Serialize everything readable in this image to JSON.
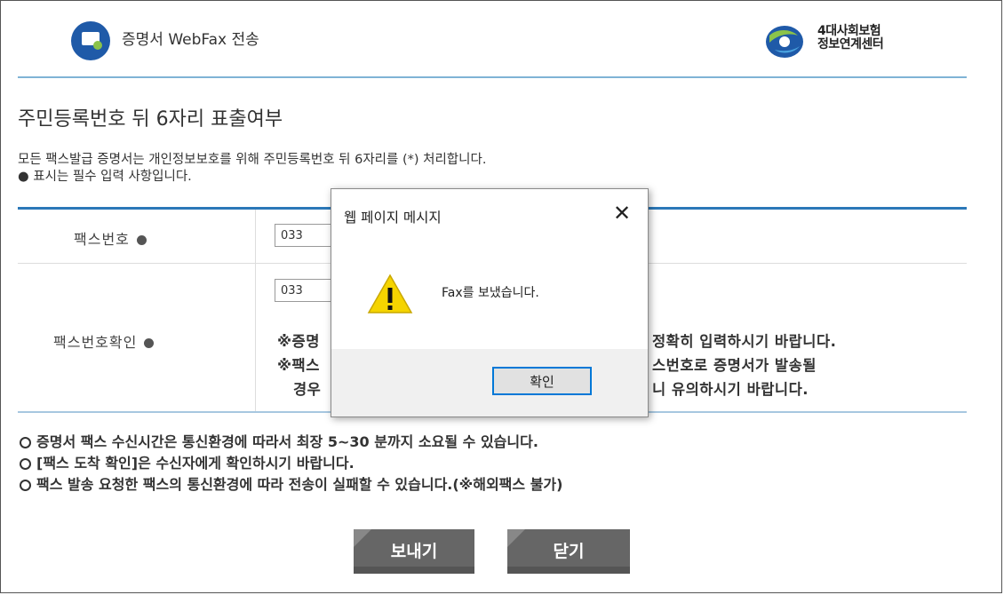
{
  "header": {
    "app_title": "증명서 WebFax 전송",
    "brand_line1": "4대사회보험",
    "brand_line2": "정보연계센터"
  },
  "page_title": "주민등록번호 뒤 6자리 표출여부",
  "description": {
    "line1": "모든 팩스발급 증명서는 개인정보보호를 위해 주민등록번호 뒤 6자리를 (*) 처리합니다.",
    "line2": "● 표시는 필수 입력 사항입니다."
  },
  "form": {
    "fax_label": "팩스번호",
    "fax_value": "033",
    "confirm_label": "팩스번호확인",
    "confirm_value": "033",
    "notice_line1a": "※증명",
    "notice_line1b": "정확히 입력하시기 바랍니다.",
    "notice_line2a": "※팩스",
    "notice_line2b": "스번호로 증명서가 발송될",
    "notice_line3a": "경우",
    "notice_line3b": "니 유의하시기 바랍니다."
  },
  "notes": [
    "증명서 팩스 수신시간은 통신환경에 따라서 최장 5~30 분까지 소요될 수 있습니다.",
    "[팩스 도착 확인]은 수신자에게 확인하시기 바랍니다.",
    "팩스 발송 요청한 팩스의 통신환경에 따라 전송이 실패할 수 있습니다.(※해외팩스 불가)"
  ],
  "buttons": {
    "send": "보내기",
    "close": "닫기"
  },
  "dialog": {
    "title": "웹 페이지 메시지",
    "close_glyph": "✕",
    "message": "Fax를 보냈습니다.",
    "ok_label": "확인",
    "warn_glyph": "!"
  }
}
